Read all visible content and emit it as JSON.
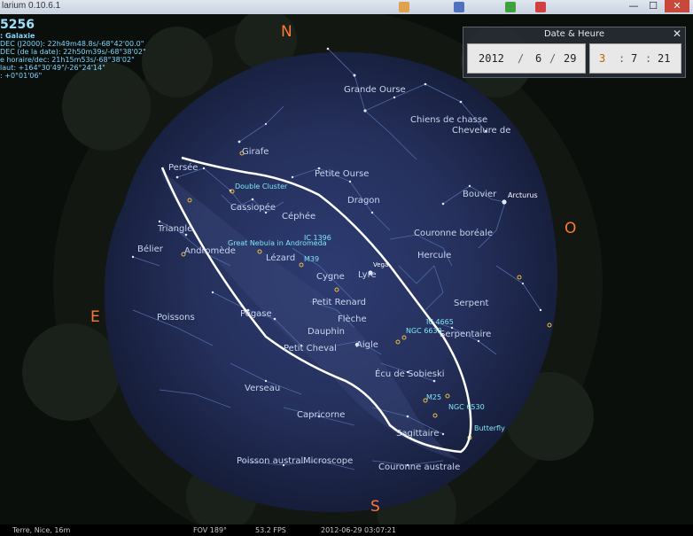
{
  "window": {
    "title": "larium 0.10.6.1",
    "minimize": "—",
    "maximize": "☐",
    "close": "✕"
  },
  "object_info": {
    "name": "5256",
    "type": ": Galaxie",
    "lines": [
      "DEC (J2000): 22h49m48.8s/-68°42'00.0\"",
      "DEC (de la date): 22h50m39s/-68°38'02\"",
      "e horaire/dec: 21h15m53s/-68°38'02\"",
      "laut: +164°30'49\"/-26°24'14\"",
      ": +0°01'06\""
    ]
  },
  "compass": {
    "north": "N",
    "south": "S",
    "east": "E",
    "west": "O"
  },
  "date_dialog": {
    "title": "Date & Heure",
    "close": "✕",
    "year": "2012",
    "month": "6",
    "day": "29",
    "hour": "3",
    "minute": "7",
    "second": "21",
    "date_sep": "/",
    "time_sep": ":"
  },
  "constellations": [
    "Grande Ourse",
    "Chiens de chasse",
    "Chevelure de",
    "Girafe",
    "Persée",
    "Petite Ourse",
    "Cassiopée",
    "Dragon",
    "Bouvier",
    "Céphée",
    "Triangle",
    "Couronne boréale",
    "Bélier",
    "Andromède",
    "Lézard",
    "Hercule",
    "Cygne",
    "Lyre",
    "Petit Renard",
    "Serpent",
    "Poissons",
    "Pégase",
    "Flèche",
    "Serpentaire",
    "Dauphin",
    "Aigle",
    "Petit Cheval",
    "Écu de Sobieski",
    "Verseau",
    "Capricorne",
    "Sagittaire",
    "Poisson austral",
    "Microscope",
    "Couronne australe"
  ],
  "deep_sky": [
    "Double Cluster",
    "IC 1396",
    "Great Nebula in Andromeda",
    "M39",
    "IC 4665",
    "NGC 6633",
    "M25",
    "NGC 6530",
    "Butterfly"
  ],
  "stars": [
    "Arcturus",
    "Vega"
  ],
  "statusbar": {
    "location": "Terre, Nice, 16m",
    "fov": "FOV 189°",
    "fps": "53.2 FPS",
    "datetime": "2012-06-29   03:07:21"
  }
}
